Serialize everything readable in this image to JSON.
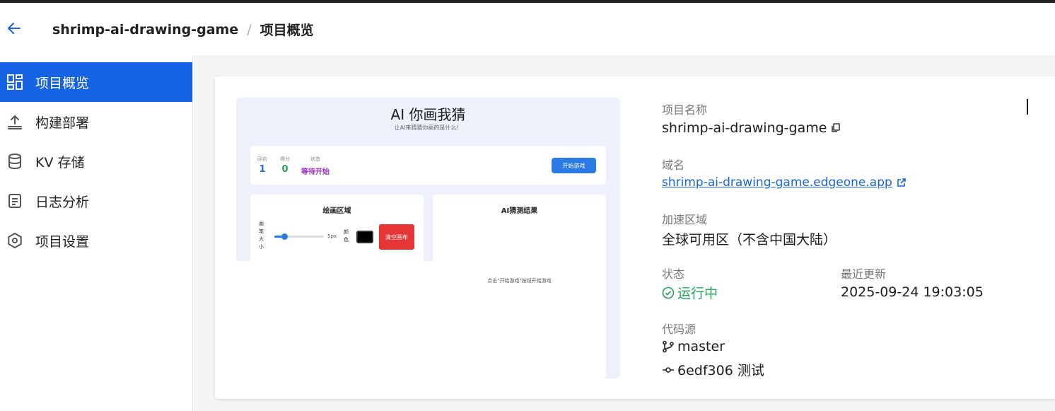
{
  "header": {
    "project_name": "shrimp-ai-drawing-game",
    "separator": "/",
    "page_title": "项目概览"
  },
  "sidebar": {
    "items": [
      {
        "label": "项目概览",
        "icon": "dashboard-icon",
        "active": true
      },
      {
        "label": "构建部署",
        "icon": "upload-icon",
        "active": false
      },
      {
        "label": "KV 存储",
        "icon": "database-icon",
        "active": false
      },
      {
        "label": "日志分析",
        "icon": "document-icon",
        "active": false
      },
      {
        "label": "项目设置",
        "icon": "settings-icon",
        "active": false
      }
    ]
  },
  "preview": {
    "title": "AI 你画我猜",
    "subtitle": "让AI来猜猜你画的是什么！",
    "stats": [
      {
        "label": "回合",
        "value": "1",
        "color": "#2a6fd8"
      },
      {
        "label": "得分",
        "value": "0",
        "color": "#1fa45a"
      },
      {
        "label": "状态",
        "value": "等待开始",
        "color": "#9b2fc9"
      }
    ],
    "start_button": "开始游戏",
    "draw_panel_title": "绘画区域",
    "brush_label": "画笔大小",
    "brush_size": "5px",
    "brush_fraction": 0.2,
    "color_label": "颜色",
    "brush_color": "#000000",
    "clear_button": "清空画布",
    "result_panel_title": "AI猜测结果",
    "result_hint": "点击\"开始游戏\"按钮开始游戏"
  },
  "info": {
    "name_label": "项目名称",
    "name_value": "shrimp-ai-drawing-game",
    "domain_label": "域名",
    "domain_value": "shrimp-ai-drawing-game.edgeone.app",
    "region_label": "加速区域",
    "region_value": "全球可用区（不含中国大陆）",
    "status_label": "状态",
    "status_value": "运行中",
    "updated_label": "最近更新",
    "updated_value": "2025-09-24 19:03:05",
    "source_label": "代码源",
    "branch": "master",
    "commit": "6edf306 测试"
  },
  "colors": {
    "accent": "#1664e5",
    "status_green": "#1fa45a",
    "danger": "#e53535"
  }
}
